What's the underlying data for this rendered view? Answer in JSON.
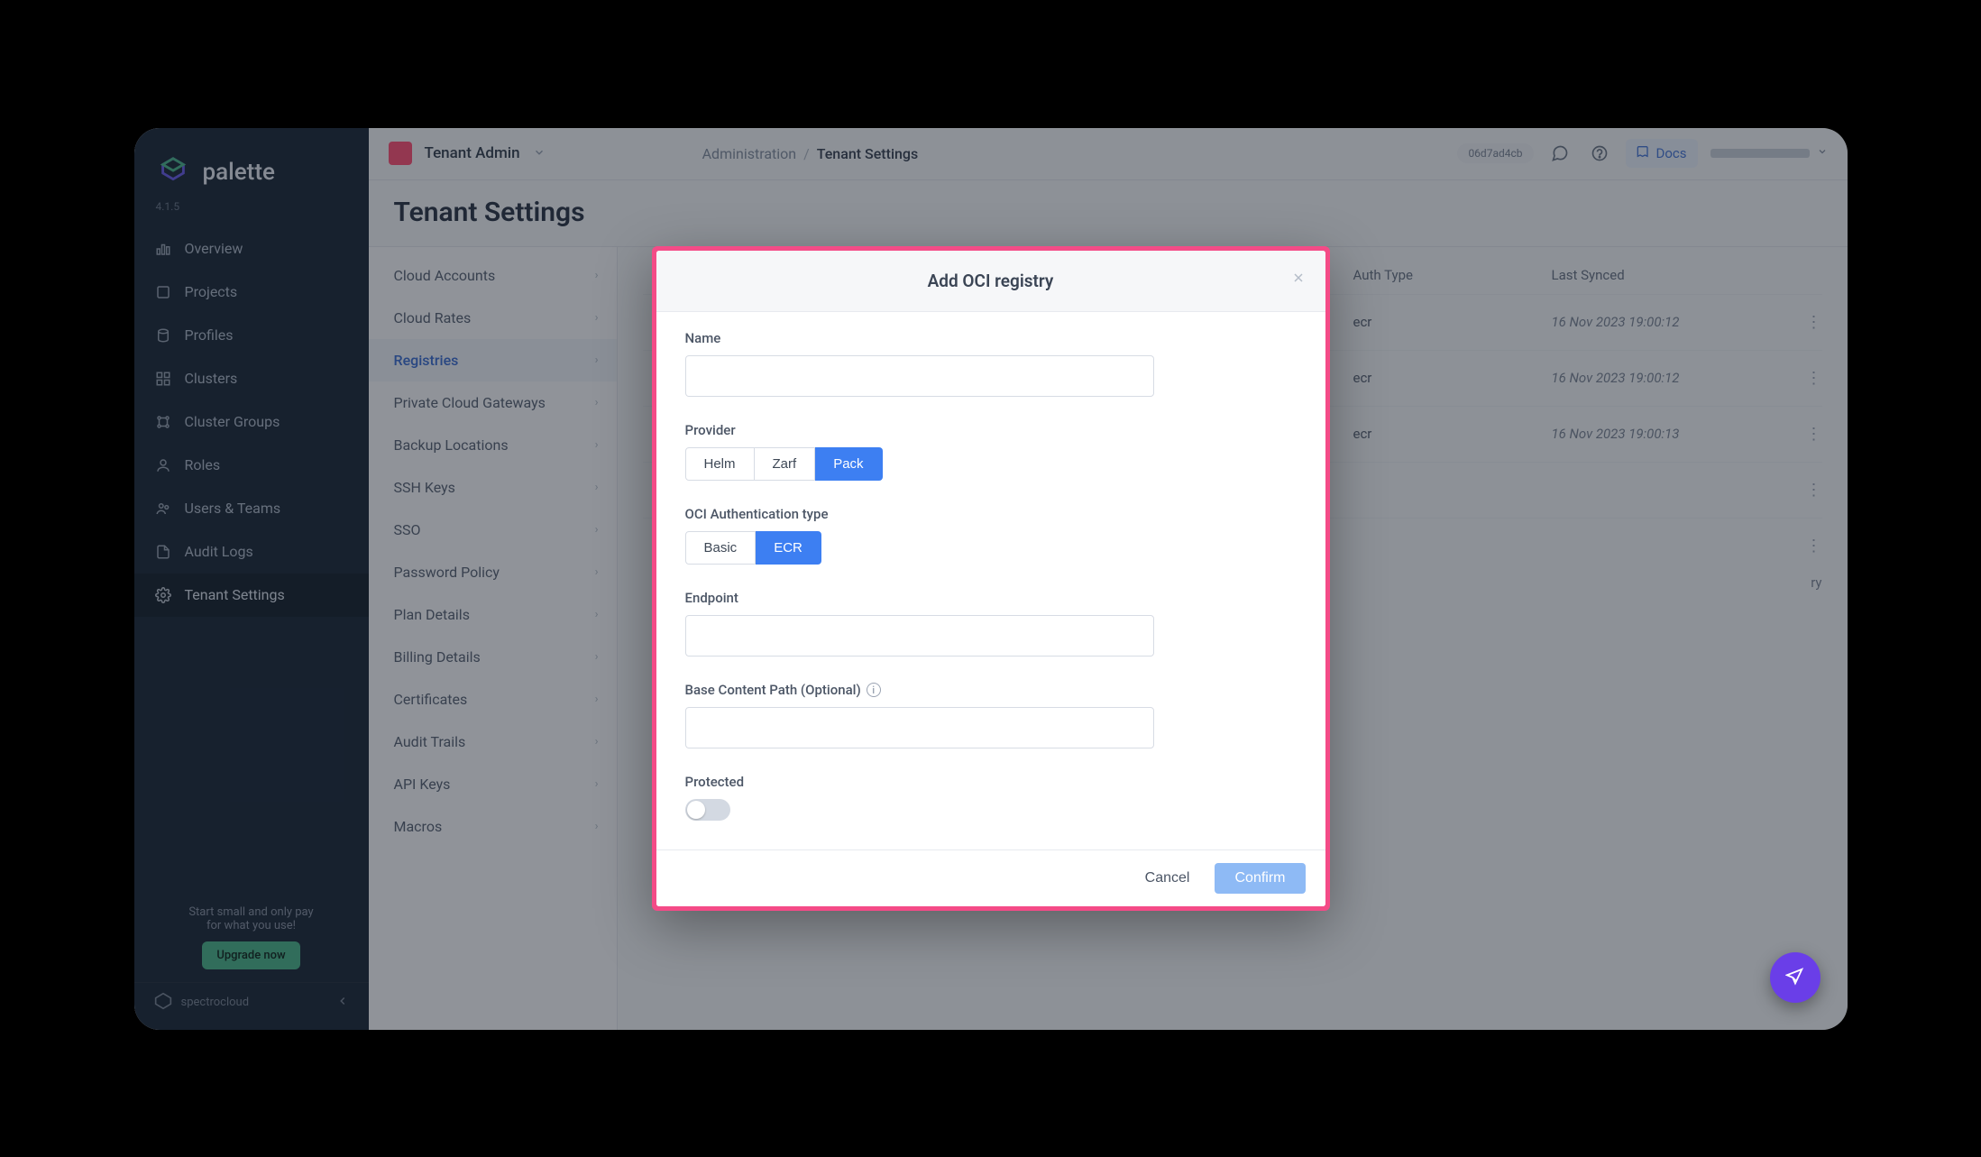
{
  "brand": {
    "name": "palette",
    "version": "4.1.5",
    "footer": "spectrocloud"
  },
  "sidebar": {
    "items": [
      {
        "label": "Overview"
      },
      {
        "label": "Projects"
      },
      {
        "label": "Profiles"
      },
      {
        "label": "Clusters"
      },
      {
        "label": "Cluster Groups"
      },
      {
        "label": "Roles"
      },
      {
        "label": "Users & Teams"
      },
      {
        "label": "Audit Logs"
      },
      {
        "label": "Tenant Settings"
      }
    ],
    "upgrade_line1": "Start small and only pay",
    "upgrade_line2": "for what you use!",
    "upgrade_btn": "Upgrade now"
  },
  "topbar": {
    "tenant_label": "Tenant Admin",
    "crumb_root": "Administration",
    "crumb_current": "Tenant Settings",
    "pill": "06d7ad4cb",
    "docs": "Docs"
  },
  "page": {
    "title": "Tenant Settings"
  },
  "settings_nav": {
    "items": [
      "Cloud Accounts",
      "Cloud Rates",
      "Registries",
      "Private Cloud Gateways",
      "Backup Locations",
      "SSH Keys",
      "SSO",
      "Password Policy",
      "Plan Details",
      "Billing Details",
      "Certificates",
      "Audit Trails",
      "API Keys",
      "Macros"
    ],
    "active_index": 2
  },
  "table": {
    "headers": {
      "auth": "Auth Type",
      "synced": "Last Synced"
    },
    "rows": [
      {
        "auth": "ecr",
        "synced": "16 Nov 2023 19:00:12"
      },
      {
        "auth": "ecr",
        "synced": "16 Nov 2023 19:00:12"
      },
      {
        "auth": "ecr",
        "synced": "16 Nov 2023 19:00:13"
      }
    ],
    "partial_text": "ry"
  },
  "modal": {
    "title": "Add OCI registry",
    "labels": {
      "name": "Name",
      "provider": "Provider",
      "auth": "OCI Authentication type",
      "endpoint": "Endpoint",
      "basepath": "Base Content Path (Optional)",
      "protected": "Protected"
    },
    "provider_options": [
      "Helm",
      "Zarf",
      "Pack"
    ],
    "provider_selected": 2,
    "auth_options": [
      "Basic",
      "ECR"
    ],
    "auth_selected": 1,
    "actions": {
      "cancel": "Cancel",
      "confirm": "Confirm"
    },
    "values": {
      "name": "",
      "endpoint": "",
      "basepath": ""
    }
  }
}
